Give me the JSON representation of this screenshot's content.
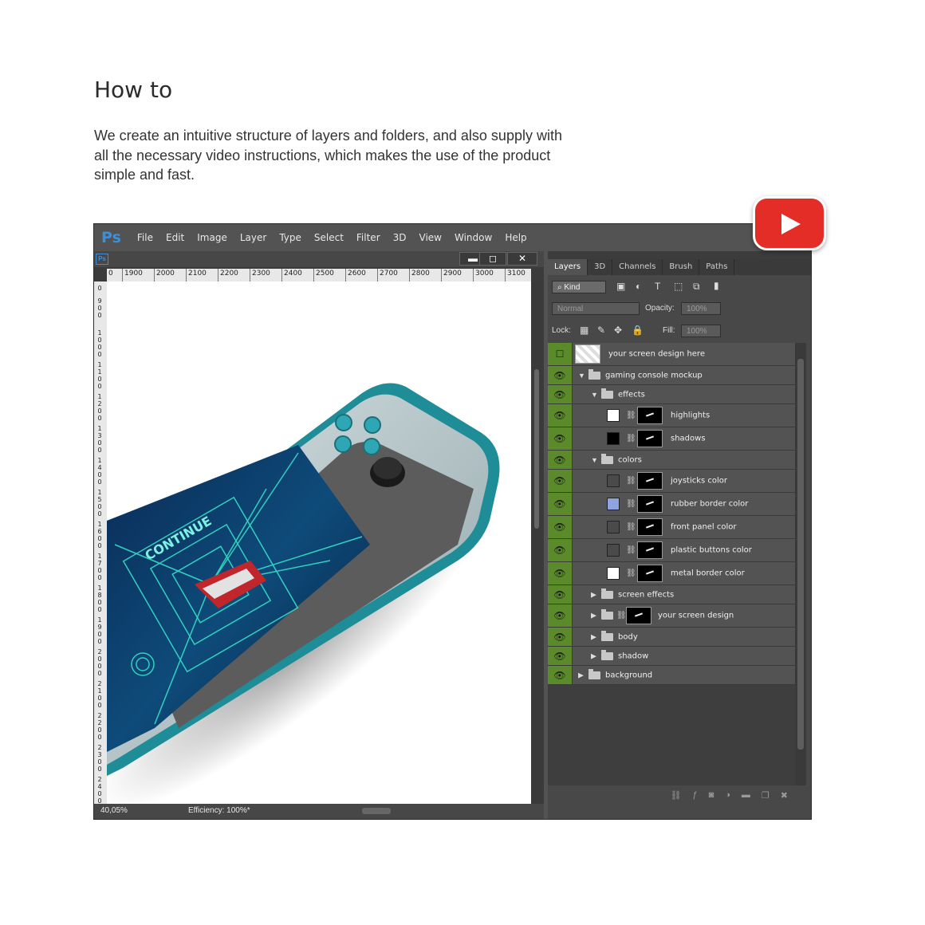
{
  "page": {
    "heading": "How to",
    "intro": "We create an intuitive structure of layers and folders, and also supply with all the necessary video instructions, which makes the use of the product simple and fast."
  },
  "app": {
    "logo": "Ps",
    "doc_logo": "Ps",
    "menu": [
      "File",
      "Edit",
      "Image",
      "Layer",
      "Type",
      "Select",
      "Filter",
      "3D",
      "View",
      "Window",
      "Help"
    ]
  },
  "document": {
    "ruler_top": [
      "0",
      "1900",
      "2000",
      "2100",
      "2200",
      "2300",
      "2400",
      "2500",
      "2600",
      "2700",
      "2800",
      "2900",
      "3000",
      "3100"
    ],
    "ruler_left": [
      "0",
      "900",
      "1000",
      "1100",
      "1200",
      "1300",
      "1400",
      "1500",
      "1600",
      "1700",
      "1800",
      "1900",
      "2000",
      "2100",
      "2200",
      "2300",
      "2400"
    ],
    "canvas_text": "CONTINUE",
    "zoom": "40,05%",
    "efficiency": "Efficiency: 100%*",
    "window_buttons": {
      "minimize": "▬",
      "restore": "◻",
      "close": "✕"
    }
  },
  "panel": {
    "tabs": [
      "Layers",
      "3D",
      "Channels",
      "Brush",
      "Paths"
    ],
    "filter_label": "Kind",
    "blend_mode": "Normal",
    "opacity_label": "Opacity:",
    "opacity_value": "100%",
    "lock_label": "Lock:",
    "fill_label": "Fill:",
    "fill_value": "100%",
    "layers": [
      {
        "name": "your screen design here",
        "type": "smart",
        "indent": 0,
        "visible": false
      },
      {
        "name": "gaming console mockup",
        "type": "folder-open",
        "indent": 0,
        "visible": true
      },
      {
        "name": "effects",
        "type": "folder-open",
        "indent": 1,
        "visible": true
      },
      {
        "name": "highlights",
        "type": "layer",
        "indent": 2,
        "visible": true,
        "swatch": "#ffffff"
      },
      {
        "name": "shadows",
        "type": "layer",
        "indent": 2,
        "visible": true,
        "swatch": "#000000"
      },
      {
        "name": "colors",
        "type": "folder-open",
        "indent": 1,
        "visible": true
      },
      {
        "name": "joysticks color",
        "type": "layer",
        "indent": 2,
        "visible": true,
        "swatch": "#4a4a4a"
      },
      {
        "name": "rubber border color",
        "type": "layer",
        "indent": 2,
        "visible": true,
        "swatch": "#8fa3e0"
      },
      {
        "name": "front panel color",
        "type": "layer",
        "indent": 2,
        "visible": true,
        "swatch": "#4a4a4a"
      },
      {
        "name": "plastic buttons color",
        "type": "layer",
        "indent": 2,
        "visible": true,
        "swatch": "#4a4a4a"
      },
      {
        "name": "metal border color",
        "type": "layer",
        "indent": 2,
        "visible": true,
        "swatch": "#ffffff"
      },
      {
        "name": "screen effects",
        "type": "folder",
        "indent": 1,
        "visible": true
      },
      {
        "name": "your screen design",
        "type": "folder-mask",
        "indent": 1,
        "visible": true
      },
      {
        "name": "body",
        "type": "folder",
        "indent": 1,
        "visible": true
      },
      {
        "name": "shadow",
        "type": "folder",
        "indent": 1,
        "visible": true
      },
      {
        "name": "background",
        "type": "folder",
        "indent": 0,
        "visible": true
      }
    ]
  },
  "colors": {
    "youtube_red": "#e52d27",
    "ps_blue": "#3d8fd6",
    "visibility_green": "#5a8a2a",
    "console_teal": "#1f8d98"
  }
}
